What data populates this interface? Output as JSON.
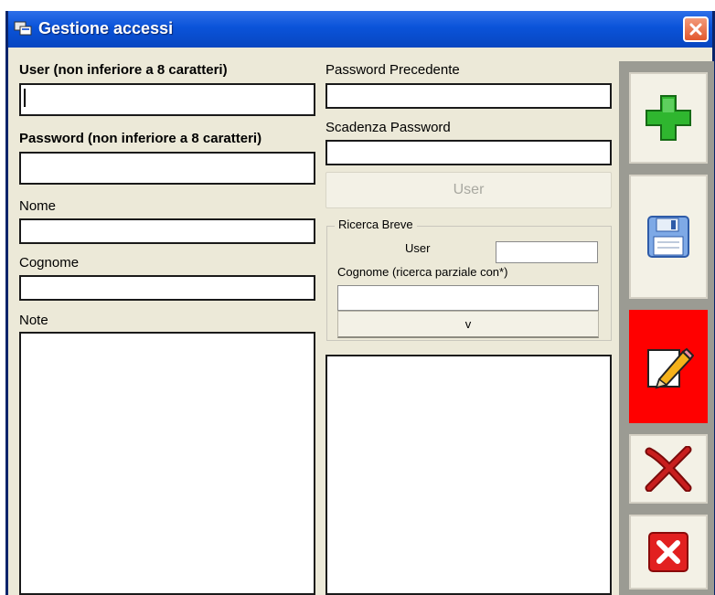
{
  "window": {
    "title": "Gestione accessi"
  },
  "form": {
    "user_label": "User (non inferiore a 8 caratteri)",
    "user_value": "",
    "password_label": "Password (non inferiore a 8 caratteri)",
    "password_value": "",
    "nome_label": "Nome",
    "nome_value": "",
    "cognome_label": "Cognome",
    "cognome_value": "",
    "note_label": "Note",
    "note_value": "",
    "password_precedente_label": "Password Precedente",
    "password_precedente_value": "",
    "scadenza_password_label": "Scadenza Password",
    "scadenza_password_value": "",
    "user_button_label": "User"
  },
  "ricerca": {
    "title": "Ricerca Breve",
    "user_label": "User",
    "user_value": "",
    "cognome_label": "Cognome (ricerca parziale con*)",
    "cognome_value": "",
    "search_button_label": "v"
  },
  "results": {
    "items": []
  },
  "toolbar": {
    "buttons": [
      {
        "icon": "add-icon",
        "state": "normal"
      },
      {
        "icon": "floppy-disk-icon",
        "state": "normal"
      },
      {
        "icon": "edit-pencil-icon",
        "state": "active",
        "color": "#ff0000"
      },
      {
        "icon": "delete-x-icon",
        "state": "normal"
      },
      {
        "icon": "exit-red-x-icon",
        "state": "normal"
      }
    ]
  },
  "colors": {
    "titlebar": "#0a53d9",
    "window_bg": "#ece9d8",
    "active_button": "#ff0000",
    "add_green": "#2fb62f"
  }
}
